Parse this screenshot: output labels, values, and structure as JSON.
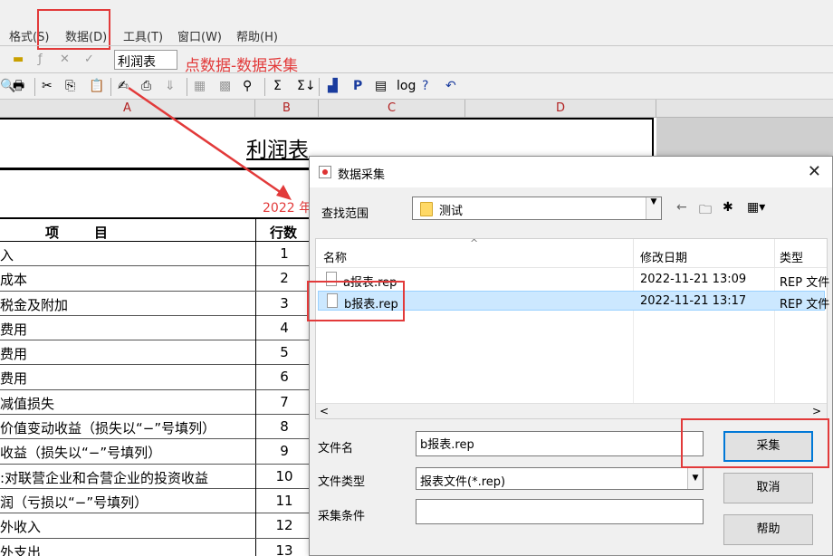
{
  "menu": [
    "格式(S)",
    "数据(D)",
    "工具(T)",
    "窗口(W)",
    "帮助(H)"
  ],
  "formula_bar": {
    "cell_value": "利润表"
  },
  "annotation": {
    "note": "点数据-数据采集",
    "accent": "#e23a3a"
  },
  "columns": [
    "A",
    "B",
    "C",
    "D"
  ],
  "sheet": {
    "title": "利润表",
    "year": "2022 年",
    "header_item": "项　　目",
    "header_line": "行数",
    "rows": [
      {
        "item": "入",
        "num": "1"
      },
      {
        "item": "成本",
        "num": "2"
      },
      {
        "item": "税金及附加",
        "num": "3"
      },
      {
        "item": "费用",
        "num": "4"
      },
      {
        "item": "费用",
        "num": "5"
      },
      {
        "item": "费用",
        "num": "6"
      },
      {
        "item": "减值损失",
        "num": "7"
      },
      {
        "item": "价值变动收益（损失以“−”号填列）",
        "num": "8"
      },
      {
        "item": "收益（损失以“−”号填列）",
        "num": "9"
      },
      {
        "item": ":对联营企业和合营企业的投资收益",
        "num": "10"
      },
      {
        "item": "润（亏损以“−”号填列）",
        "num": "11"
      },
      {
        "item": "外收入",
        "num": "12"
      },
      {
        "item": "外支出",
        "num": "13"
      }
    ]
  },
  "dialog": {
    "title": "数据采集",
    "look_in_label": "查找范围",
    "look_in_value": "测试",
    "columns": {
      "name": "名称",
      "modified": "修改日期",
      "type": "类型"
    },
    "files": [
      {
        "name": "a报表.rep",
        "modified": "2022-11-21 13:09",
        "type": "REP 文件"
      },
      {
        "name": "b报表.rep",
        "modified": "2022-11-21 13:17",
        "type": "REP 文件",
        "selected": true
      }
    ],
    "filename_label": "文件名",
    "filename_value": "b报表.rep",
    "filetype_label": "文件类型",
    "filetype_value": "报表文件(*.rep)",
    "condition_label": "采集条件",
    "condition_value": "",
    "buttons": {
      "collect": "采集",
      "cancel": "取消",
      "help": "帮助"
    }
  }
}
